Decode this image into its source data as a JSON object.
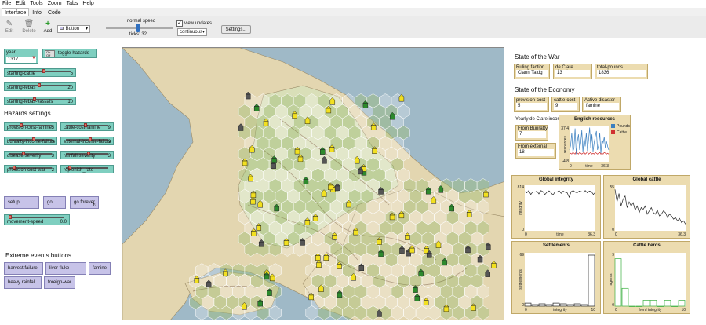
{
  "menu": [
    "File",
    "Edit",
    "Tools",
    "Zoom",
    "Tabs",
    "Help"
  ],
  "tabs": [
    "Interface",
    "Info",
    "Code"
  ],
  "toolbar": {
    "edit": "Edit",
    "delete": "Delete",
    "add": "Add",
    "widget_type": "Button",
    "speed_label": "normal speed",
    "ticks": "ticks: 32",
    "view_updates": "view updates",
    "update_mode": "continuous",
    "settings": "Settings..."
  },
  "left": {
    "year_label": "year",
    "year_value": "1317",
    "toggle_hazards": "toggle-hazards",
    "switch_on": "On",
    "switch_off": "Off",
    "sliders_top": [
      {
        "label": "starting-cattle",
        "value": "5",
        "pos": 0.55
      },
      {
        "label": "starting-febas",
        "value": "20",
        "pos": 0.48
      },
      {
        "label": "starting-febas-vassals",
        "value": "10",
        "pos": 0.4
      }
    ],
    "hazards_heading": "Hazards settings",
    "hazard_sliders": [
      {
        "label": "provision-cost-famine",
        "value": "5",
        "pos": 0.25
      },
      {
        "label": "cattle-cost-famine",
        "value": "9",
        "pos": 0.45
      },
      {
        "label": "bunratty-income-failure",
        "value": "9",
        "pos": 0.55
      },
      {
        "label": "external-income-failure",
        "value": "9",
        "pos": 0.55
      },
      {
        "label": "disease-severity",
        "value": "3",
        "pos": 0.3
      },
      {
        "label": "rainfall-severity",
        "value": "3",
        "pos": 0.52
      },
      {
        "label": "provision-cost-war",
        "value": "2",
        "pos": 0.08
      },
      {
        "label": "replenish_rate",
        "value": "",
        "pos": 0.05
      }
    ],
    "setup": "setup",
    "go": "go",
    "go_forever": "go forever",
    "movement_speed_label": "movement-speed",
    "movement_speed_value": "0.0",
    "extreme_heading": "Extreme events buttons",
    "extreme_buttons": [
      "harvest failure",
      "liver fluke disease",
      "famine",
      "heavy rainfall",
      "foreign-war"
    ]
  },
  "right": {
    "war_heading": "State of the War",
    "ruling_faction_label": "Ruling faction",
    "ruling_faction_value": "Clann Taidg",
    "de_clare_victories_label": "de Clare victories",
    "de_clare_victories_value": "13",
    "total_pounds_label": "total-pounds",
    "total_pounds_value": "1836",
    "economy_heading": "State of the Economy",
    "provision_cost_label": "provision-cost",
    "provision_cost_value": "5",
    "cattle_cost_label": "cattle-cost",
    "cattle_cost_value": "9",
    "active_disaster_label": "Active disaster",
    "active_disaster_value": "famine",
    "yearly_income_label": "Yearly de Clare income",
    "from_bunratty_label": "From Bunratty",
    "from_bunratty_value": "7",
    "from_external_label": "From external manors",
    "from_external_value": "18"
  },
  "chart_data": [
    {
      "type": "line",
      "title": "English resources",
      "xlabel": "time",
      "ylabel": "resources",
      "xlim": [
        0,
        36.3
      ],
      "ylim": [
        -4.8,
        37.4
      ],
      "x_tick_labels": [
        "0",
        "36.3"
      ],
      "y_tick_labels": [
        "-4.8",
        "37.4"
      ],
      "legend": "top-right",
      "series": [
        {
          "name": "Pounds",
          "color": "#3a7fc0",
          "values": [
            10,
            15,
            30,
            8,
            12,
            35,
            5,
            20,
            28,
            10,
            18,
            33,
            7,
            25,
            14,
            30,
            9,
            22,
            36,
            12,
            28,
            8,
            18,
            26,
            32,
            10,
            15,
            30,
            6,
            22,
            18,
            25,
            12,
            20,
            14,
            10
          ]
        },
        {
          "name": "Cattle",
          "color": "#d03030",
          "values": [
            5,
            6,
            5,
            7,
            6,
            5,
            8,
            6,
            5,
            7,
            6,
            5,
            6,
            7,
            5,
            6,
            8,
            5,
            6,
            7,
            5,
            6,
            5,
            7,
            6,
            5,
            6,
            7,
            5,
            6,
            5,
            7,
            6,
            5,
            6,
            5
          ]
        }
      ]
    },
    {
      "type": "line",
      "title": "Global integrity",
      "xlabel": "time",
      "ylabel": "integrity",
      "xlim": [
        0,
        36.3
      ],
      "ylim": [
        0,
        814
      ],
      "x_tick_labels": [
        "0",
        "36.3"
      ],
      "y_tick_labels": [
        "0",
        "814"
      ],
      "series": [
        {
          "color": "#222",
          "values": [
            700,
            680,
            720,
            650,
            700,
            690,
            710,
            660,
            720,
            700,
            650,
            690,
            715,
            680,
            640,
            700,
            690,
            720,
            670,
            710,
            690,
            680,
            600,
            700,
            720,
            690,
            680,
            710,
            700,
            690,
            720,
            680,
            710,
            700,
            650,
            690
          ]
        }
      ]
    },
    {
      "type": "line",
      "title": "Global cattle",
      "xlabel": "",
      "ylabel": "",
      "xlim": [
        0,
        36.3
      ],
      "ylim": [
        0,
        55
      ],
      "x_tick_labels": [
        "0",
        "36.3"
      ],
      "y_tick_labels": [
        "0",
        "55"
      ],
      "series": [
        {
          "color": "#222",
          "values": [
            50,
            35,
            45,
            30,
            38,
            42,
            28,
            35,
            30,
            34,
            25,
            30,
            22,
            28,
            26,
            30,
            20,
            24,
            28,
            22,
            20,
            25,
            18,
            20,
            24,
            22,
            16,
            20,
            18,
            14,
            16,
            12,
            15,
            10,
            12,
            8
          ]
        }
      ]
    },
    {
      "type": "bar",
      "title": "Settlements",
      "xlabel": "integrity",
      "ylabel": "settlements",
      "xlim": [
        0,
        10
      ],
      "ylim": [
        0,
        69
      ],
      "x_tick_labels": [
        "0",
        "10"
      ],
      "y_tick_labels": [
        "0",
        "69"
      ],
      "values": [
        4,
        2,
        3,
        2,
        4,
        3,
        2,
        3,
        2,
        66
      ],
      "bar_color": "#222"
    },
    {
      "type": "bar",
      "title": "Cattle herds",
      "xlabel": "herd integrity",
      "ylabel": "agents",
      "xlim": [
        0,
        10
      ],
      "ylim": [
        0,
        9
      ],
      "x_tick_labels": [
        "0",
        "10"
      ],
      "y_tick_labels": [
        "0",
        "9"
      ],
      "values": [
        8,
        3,
        0,
        0,
        1,
        1,
        0,
        1,
        0,
        1
      ],
      "bar_color": "#3ab040"
    }
  ],
  "map": {
    "sea_color": "#9fb9c7",
    "land_color": "#e3d6b0"
  }
}
